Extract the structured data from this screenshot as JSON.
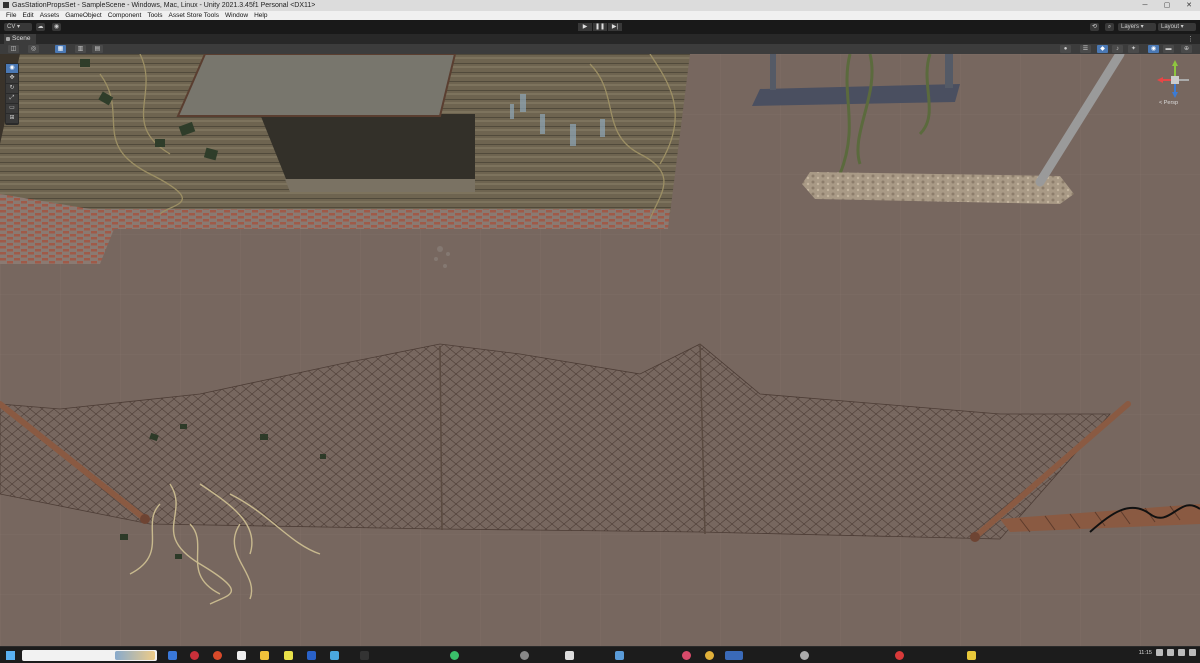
{
  "titlebar": {
    "title": "GasStationPropsSet - SampleScene - Windows, Mac, Linux - Unity 2021.3.45f1 Personal <DX11>",
    "minimize": "─",
    "maximize": "▢",
    "close": "✕"
  },
  "menubar": {
    "items": [
      "File",
      "Edit",
      "Assets",
      "GameObject",
      "Component",
      "Tools",
      "Asset Store Tools",
      "Window",
      "Help"
    ]
  },
  "toolbar": {
    "account_label": "CV",
    "layers_label": "Layers",
    "layout_label": "Layout",
    "play_icon": "▶",
    "pause_icon": "❚❚",
    "step_icon": "▶|"
  },
  "scene": {
    "tab_label": "Scene",
    "persp_label": "< Persp",
    "gizmo_axes": [
      "x",
      "y",
      "z"
    ]
  },
  "taskbar": {
    "time": "11:15"
  },
  "colors": {
    "ground": "#77675f",
    "grid": "#8a7b73",
    "accent": "#4a78b4"
  }
}
